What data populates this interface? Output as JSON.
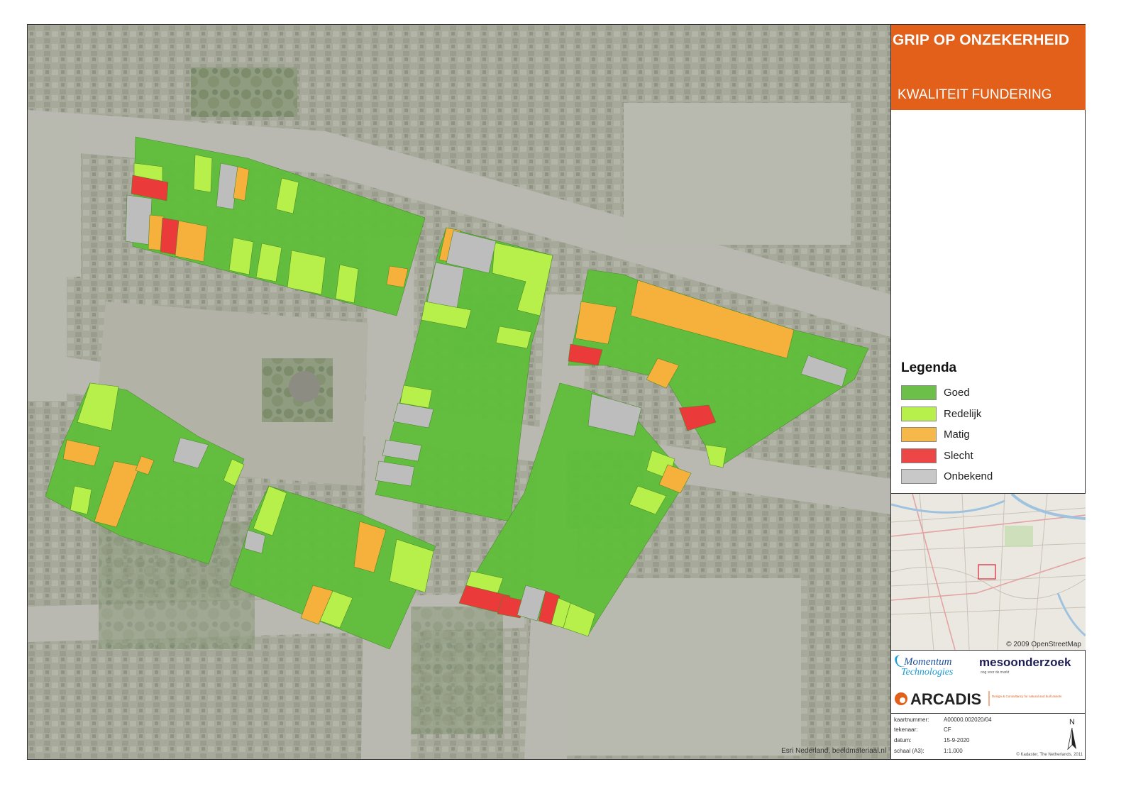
{
  "header": {
    "title": "GRIP OP ONZEKERHEID",
    "subtitle": "KWALITEIT FUNDERING"
  },
  "legend": {
    "title": "Legenda",
    "items": [
      {
        "label": "Goed",
        "color": "#5fbf3a"
      },
      {
        "label": "Redelijk",
        "color": "#b7f04a"
      },
      {
        "label": "Matig",
        "color": "#f5b13c"
      },
      {
        "label": "Slecht",
        "color": "#ea3a3a"
      },
      {
        "label": "Onbekend",
        "color": "#bdbdbd"
      }
    ]
  },
  "map": {
    "credit": "Esri Nederland, beeldmateriaal.nl",
    "base_color": "#a9ad9e"
  },
  "overview": {
    "credit": "© 2009 OpenStreetMap"
  },
  "logos": {
    "momentum_line1": "Momentum",
    "momentum_line2": "Technologies",
    "meso": "mesoonderzoek",
    "meso_tag": "oog voor de markt",
    "arcadis": "ARCADIS",
    "arcadis_tag": "Design & Consultancy for natural and built assets"
  },
  "meta": {
    "rows": [
      {
        "key": "kaartnummer:",
        "value": "A00000.002020/04"
      },
      {
        "key": "tekenaar:",
        "value": "CF"
      },
      {
        "key": "datum:",
        "value": "15-9-2020"
      },
      {
        "key": "schaal (A3):",
        "value": "1:1.000"
      }
    ],
    "copyright": "© Kadaster, The Netherlands, 2011",
    "north": "N"
  },
  "colors": {
    "brand_orange": "#e2601a",
    "goed": "#5fbf3a",
    "redelijk": "#b7f04a",
    "matig": "#f5b13c",
    "slecht": "#ea3a3a",
    "onbekend": "#bdbdbd"
  }
}
